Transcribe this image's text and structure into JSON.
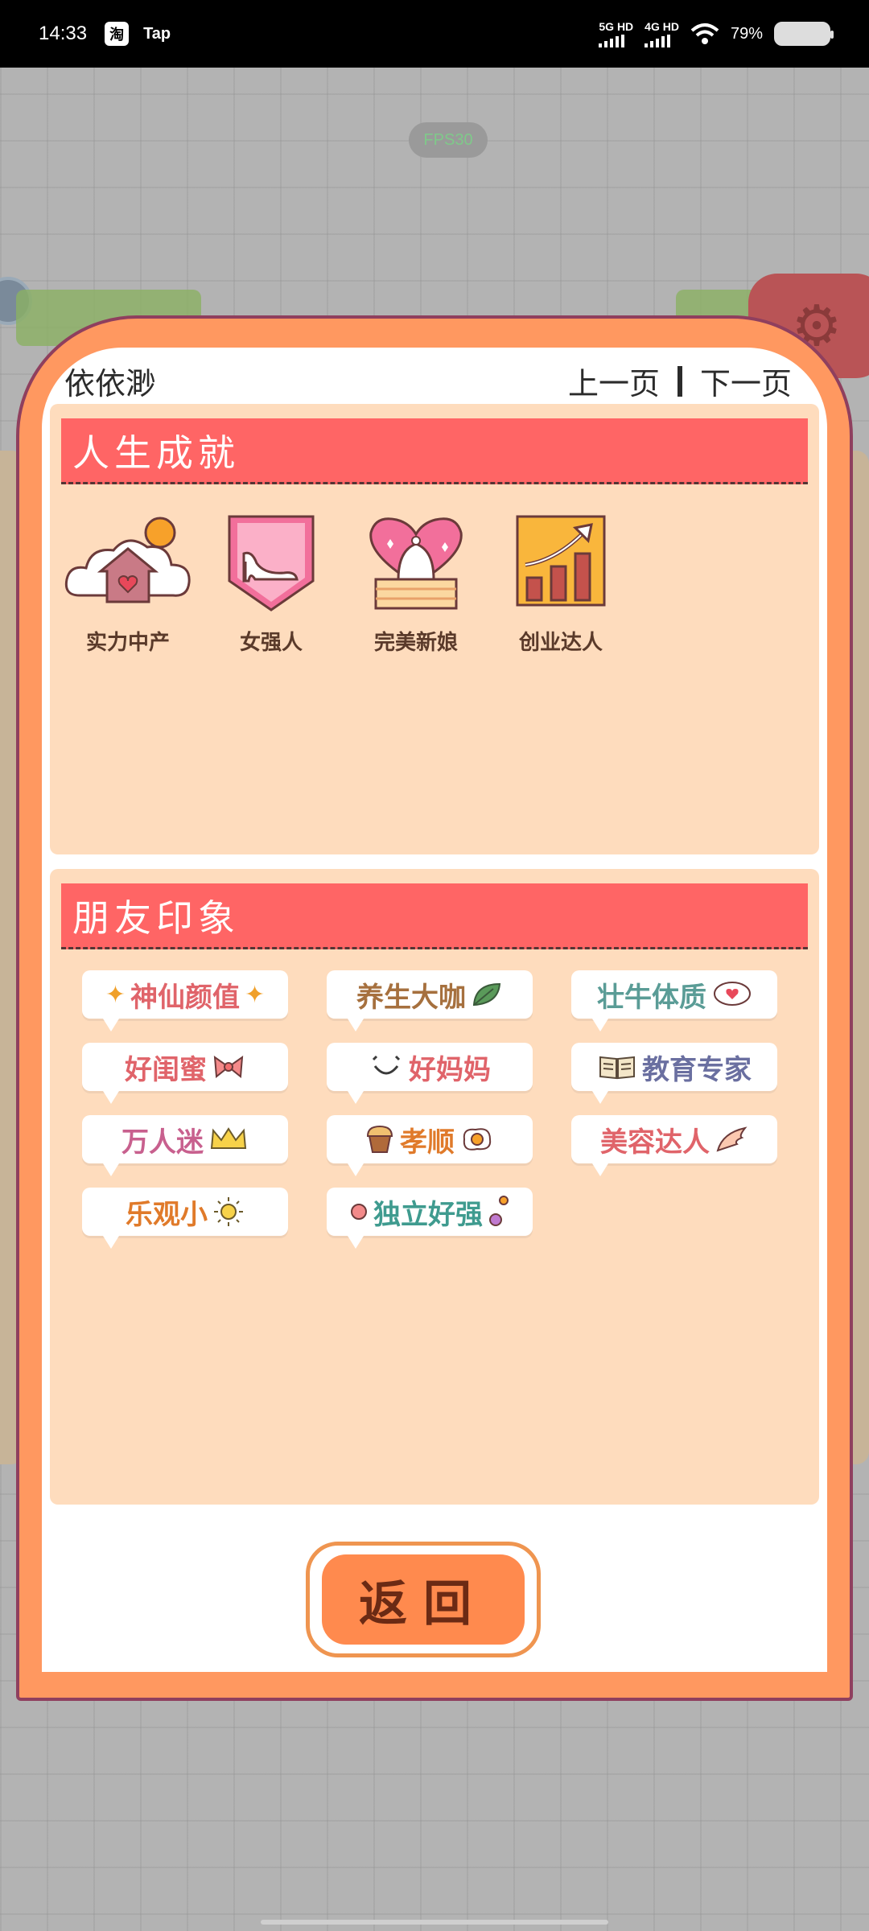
{
  "status_bar": {
    "time": "14:33",
    "app_badge": "淘",
    "app_label": "Tap",
    "network_1": "5G HD",
    "network_2": "4G HD",
    "battery": "79%"
  },
  "game_bg": {
    "fps": "FPS30"
  },
  "modal": {
    "player_name": "依依渺",
    "prev_page": "上一页",
    "next_page": "下一页",
    "achievements": {
      "title": "人生成就",
      "items": [
        {
          "label": "实力中产",
          "icon": "house-cloud-icon"
        },
        {
          "label": "女强人",
          "icon": "high-heel-icon"
        },
        {
          "label": "完美新娘",
          "icon": "wedding-cake-icon"
        },
        {
          "label": "创业达人",
          "icon": "growth-chart-icon"
        }
      ]
    },
    "impressions": {
      "title": "朋友印象",
      "tags": [
        {
          "label": "神仙颜值",
          "color": "#e0646a",
          "icon": "sparkle-icon"
        },
        {
          "label": "养生大咖",
          "color": "#a6703e",
          "icon": "leaf-icon"
        },
        {
          "label": "壮牛体质",
          "color": "#5a9c96",
          "icon": "heart-bubble-icon"
        },
        {
          "label": "好闺蜜",
          "color": "#e0646a",
          "icon": "bow-icon"
        },
        {
          "label": "好妈妈",
          "color": "#e0646a",
          "icon": "smile-icon"
        },
        {
          "label": "教育专家",
          "color": "#6a6fa0",
          "icon": "book-icon"
        },
        {
          "label": "万人迷",
          "color": "#c8608e",
          "icon": "crown-icon"
        },
        {
          "label": "孝顺",
          "color": "#e07a2a",
          "icon": "muffin-egg-icon"
        },
        {
          "label": "美容达人",
          "color": "#e0646a",
          "icon": "wing-icon"
        },
        {
          "label": "乐观小",
          "color": "#e07a2a",
          "icon": "sun-icon"
        },
        {
          "label": "独立好强",
          "color": "#3f9b8f",
          "icon": "dots-icon"
        }
      ]
    },
    "return_button": "返回"
  }
}
